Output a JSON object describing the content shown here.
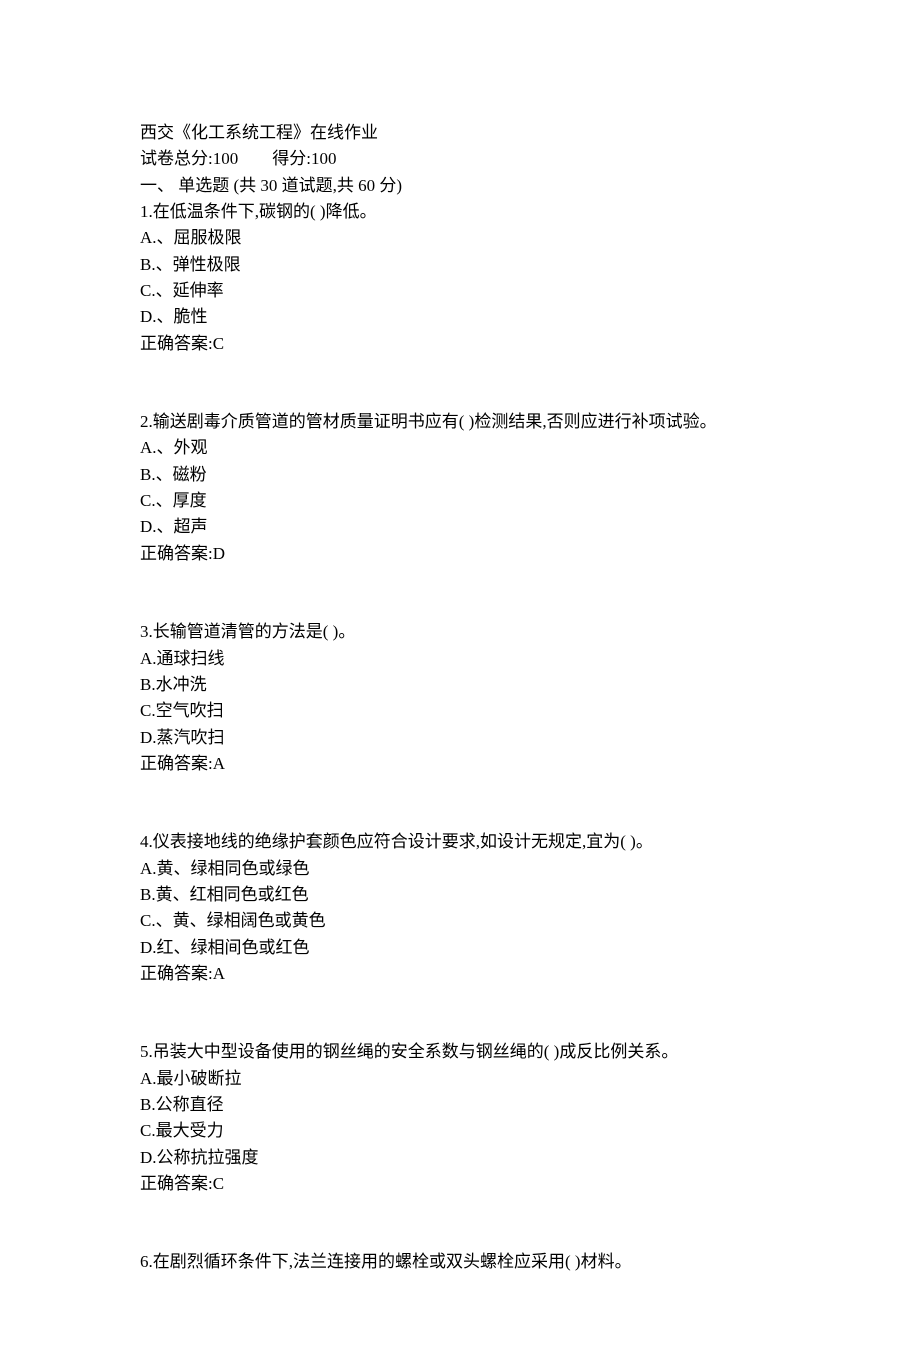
{
  "header": {
    "title": "西交《化工系统工程》在线作业",
    "score_total_label": "试卷总分:",
    "score_total_value": "100",
    "score_got_label": "得分:",
    "score_got_value": "100",
    "section_line": "一、 单选题 (共 30 道试题,共 60 分)"
  },
  "answer_label_prefix": "正确答案:",
  "questions": [
    {
      "num": "1",
      "stem": "在低温条件下,碳钢的( )降低。",
      "opts": [
        {
          "k": "A",
          "v": ".、屈服极限"
        },
        {
          "k": "B",
          "v": ".、弹性极限"
        },
        {
          "k": "C",
          "v": ".、延伸率"
        },
        {
          "k": "D",
          "v": ".、脆性"
        }
      ],
      "ans": "C"
    },
    {
      "num": "2",
      "stem": "输送剧毒介质管道的管材质量证明书应有( )检测结果,否则应进行补项试验。",
      "opts": [
        {
          "k": "A",
          "v": ".、外观"
        },
        {
          "k": "B",
          "v": ".、磁粉"
        },
        {
          "k": "C",
          "v": ".、厚度"
        },
        {
          "k": "D",
          "v": ".、超声"
        }
      ],
      "ans": "D"
    },
    {
      "num": "3",
      "stem": "长输管道清管的方法是( )。",
      "opts": [
        {
          "k": "A",
          "v": ".通球扫线"
        },
        {
          "k": "B",
          "v": ".水冲洗"
        },
        {
          "k": "C",
          "v": ".空气吹扫"
        },
        {
          "k": "D",
          "v": ".蒸汽吹扫"
        }
      ],
      "ans": "A"
    },
    {
      "num": "4",
      "stem": "仪表接地线的绝缘护套颜色应符合设计要求,如设计无规定,宜为( )。",
      "opts": [
        {
          "k": "A",
          "v": ".黄、绿相同色或绿色"
        },
        {
          "k": "B",
          "v": ".黄、红相同色或红色"
        },
        {
          "k": "C",
          "v": ".、黄、绿相阔色或黄色"
        },
        {
          "k": "D",
          "v": ".红、绿相间色或红色"
        }
      ],
      "ans": "A"
    },
    {
      "num": "5",
      "stem": "吊装大中型设备使用的钢丝绳的安全系数与钢丝绳的( )成反比例关系。",
      "opts": [
        {
          "k": "A",
          "v": ".最小破断拉"
        },
        {
          "k": "B",
          "v": ".公称直径"
        },
        {
          "k": "C",
          "v": ".最大受力"
        },
        {
          "k": "D",
          "v": ".公称抗拉强度"
        }
      ],
      "ans": "C"
    },
    {
      "num": "6",
      "stem": "在剧烈循环条件下,法兰连接用的螺栓或双头螺栓应采用( )材料。",
      "opts": [],
      "ans": null
    }
  ]
}
